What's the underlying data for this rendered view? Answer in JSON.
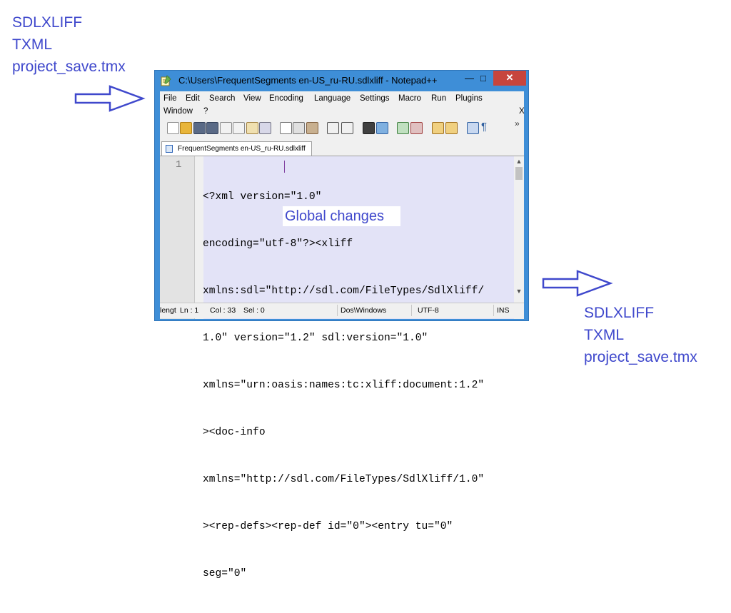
{
  "annotations": {
    "left_formats": [
      "SDLXLIFF",
      "TXML",
      "project_save.tmx"
    ],
    "right_formats": [
      "SDLXLIFF",
      "TXML",
      "project_save.tmx"
    ],
    "overlay_label": "Global changes",
    "accent_color": "#3f48cc"
  },
  "window": {
    "title": "C:\\Users\\FrequentSegments en-US_ru-RU.sdlxliff - Notepad++",
    "minimize_glyph": "—",
    "maximize_glyph": "□",
    "close_glyph": "✕"
  },
  "menu": {
    "file": "File",
    "edit": "Edit",
    "search": "Search",
    "view": "View",
    "encoding": "Encoding",
    "language": "Language",
    "settings": "Settings",
    "macro": "Macro",
    "run": "Run",
    "plugins": "Plugins",
    "window": "Window",
    "help": "?",
    "close_doc": "X"
  },
  "toolbar": {
    "icons": [
      "new-file-icon",
      "open-file-icon",
      "save-icon",
      "save-all-icon",
      "close-icon",
      "close-all-icon",
      "print-icon",
      "cut-icon",
      "copy-icon",
      "paste-icon",
      "undo-icon",
      "redo-icon",
      "find-icon",
      "replace-icon",
      "zoom-in-icon",
      "zoom-out-icon",
      "sync-v-icon",
      "sync-h-icon",
      "wrap-icon",
      "show-all-chars-icon"
    ],
    "pilcrow": "¶",
    "overflow": "»"
  },
  "tab": {
    "label": "FrequentSegments en-US_ru-RU.sdlxliff"
  },
  "editor": {
    "line_number": "1",
    "lines": [
      "<?xml version=\"1.0\"",
      "encoding=\"utf-8\"?><xliff",
      "xmlns:sdl=\"http://sdl.com/FileTypes/SdlXliff/",
      "1.0\" version=\"1.2\" sdl:version=\"1.0\"",
      "xmlns=\"urn:oasis:names:tc:xliff:document:1.2\"",
      "><doc-info",
      "xmlns=\"http://sdl.com/FileTypes/SdlXliff/1.0\"",
      "><rep-defs><rep-def id=\"0\"><entry tu=\"0\"",
      "seg=\"0\""
    ],
    "scroll_up": "▲",
    "scroll_down": "▼"
  },
  "status": {
    "length": "lengt",
    "ln": "Ln : 1",
    "col": "Col : 33",
    "sel": "Sel : 0",
    "eol": "Dos\\Windows",
    "encoding": "UTF-8",
    "mode": "INS"
  }
}
